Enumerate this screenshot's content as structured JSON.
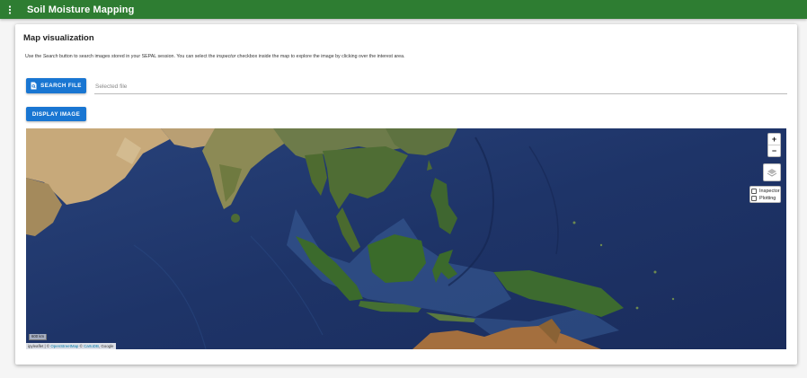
{
  "app": {
    "title": "Soil Moisture Mapping",
    "menu_icon": "dots-vertical-icon",
    "header_color": "#2e7d32"
  },
  "card": {
    "title": "Map visualization",
    "help": {
      "part1": "Use the ",
      "search_word": "Search",
      "part2": " button to search images stored in your SEPAL session. You can select the ",
      "inspector_word": "inspector",
      "part3": " checkbox inside the map to explore the image by clicking over the interest area."
    }
  },
  "controls": {
    "search_button_label": "SEARCH FILE",
    "search_button_icon": "file-search-icon",
    "file_placeholder": "Selected file",
    "display_button_label": "DISPLAY IMAGE",
    "button_color": "#1976d2"
  },
  "map": {
    "zoom_in": "+",
    "zoom_out": "−",
    "layers_icon": "layers-icon",
    "checkboxes": [
      {
        "label": "Inspector",
        "checked": false
      },
      {
        "label": "Plotting",
        "checked": false
      }
    ],
    "scale_label": "600 km",
    "attribution": {
      "prefix": "ipyleaflet | © ",
      "osm": "OpenStreetMap",
      "mid": " © ",
      "carto": "CartoDB",
      "suffix": ", Google"
    }
  }
}
